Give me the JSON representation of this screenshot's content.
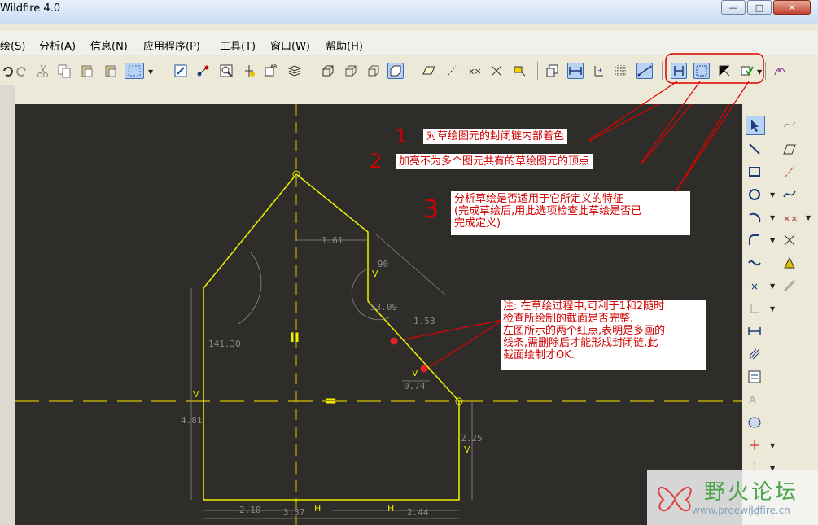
{
  "window": {
    "title": "Wildfire 4.0",
    "minimize": "—",
    "maximize": "□",
    "close": "✕"
  },
  "menu": [
    {
      "label": "绘(S)"
    },
    {
      "label": "分析(A)"
    },
    {
      "label": "信息(N)"
    },
    {
      "label": "应用程序(P)"
    },
    {
      "label": "工具(T)"
    },
    {
      "label": "窗口(W)"
    },
    {
      "label": "帮助(H)"
    }
  ],
  "annotations": {
    "num1": "1",
    "num2": "2",
    "num3": "3",
    "note1": "对草绘图元的封闭链内部着色",
    "note2": "加亮不为多个图元共有的草绘图元的顶点",
    "note3_line1": "分析草绘是否适用于它所定义的特征",
    "note3_line2": "(完成草绘后,用此选项检查此草绘是否已",
    "note3_line3": "完成定义)",
    "note4_line1": "注: 在草绘过程中,可利于1和2随时",
    "note4_line2": "检查所绘制的截面是否完整.",
    "note4_line3": "左图所示的两个红点,表明是多画的",
    "note4_line4": "线条,需删除后才能形成封闭链,此",
    "note4_line5": "截面绘制才OK."
  },
  "sketch": {
    "dimensions": [
      "1.61",
      "90",
      "V",
      "53.09",
      "1.53",
      "141.30",
      "0.74",
      "4.81",
      "2.25",
      "2.10",
      "3.37",
      "2.44",
      "V",
      "V",
      "H",
      "H",
      "V"
    ],
    "symbols": {
      "equal": "=",
      "parallel": "II"
    }
  },
  "watermark": {
    "title": "野火论坛",
    "url": "www.proewildfire.cn"
  },
  "colors": {
    "canvas": "#2e2d2a",
    "geometry": "#f0f000",
    "centerline": "#d4c200",
    "dimension": "#8a8a8a",
    "annotation": "#d00000",
    "highlight_box": "#e00000"
  }
}
